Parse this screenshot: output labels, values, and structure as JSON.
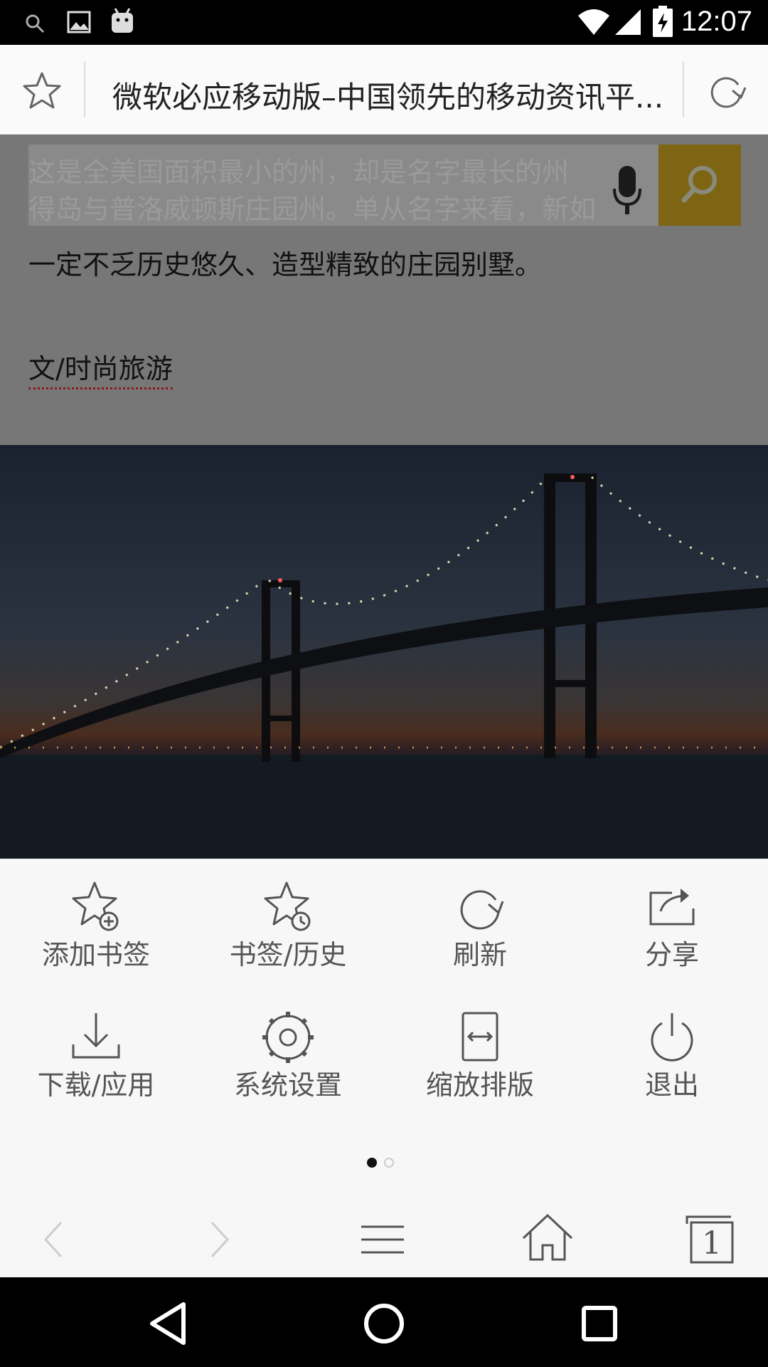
{
  "status_bar": {
    "time": "12:07",
    "left_icons": [
      "search-icon",
      "image-icon",
      "android-icon"
    ],
    "right_icons": [
      "wifi-icon",
      "signal-icon",
      "battery-charging-icon"
    ]
  },
  "address_bar": {
    "page_title": "微软必应移动版–中国领先的移动资讯平...",
    "bookmark_icon": "star-outline-icon",
    "reload_icon": "reload-icon"
  },
  "page": {
    "search_text": "这是全美国面积最小的州，却是名字最长的州",
    "search_text_line2": "得岛与普洛威顿斯庄园州。单从名字来看，新如",
    "article_line": "一定不乏历史悠久、造型精致的庄园别墅。",
    "article_author": "文/时尚旅游",
    "search_button_color": "#7d6514"
  },
  "menu": {
    "items": [
      {
        "label": "添加书签",
        "icon": "star-plus-icon"
      },
      {
        "label": "书签/历史",
        "icon": "star-clock-icon"
      },
      {
        "label": "刷新",
        "icon": "refresh-icon"
      },
      {
        "label": "分享",
        "icon": "share-icon"
      },
      {
        "label": "下载/应用",
        "icon": "download-icon"
      },
      {
        "label": "系统设置",
        "icon": "gear-icon"
      },
      {
        "label": "缩放排版",
        "icon": "resize-icon"
      },
      {
        "label": "退出",
        "icon": "power-icon"
      }
    ],
    "page_count": 2,
    "active_page": 1
  },
  "toolbar": {
    "back_icon": "chevron-left-icon",
    "forward_icon": "chevron-right-icon",
    "menu_icon": "hamburger-icon",
    "home_icon": "home-icon",
    "tabs_count": "1"
  },
  "nav_bar": {
    "back": "triangle-back-icon",
    "home": "circle-home-icon",
    "recents": "square-recents-icon"
  }
}
